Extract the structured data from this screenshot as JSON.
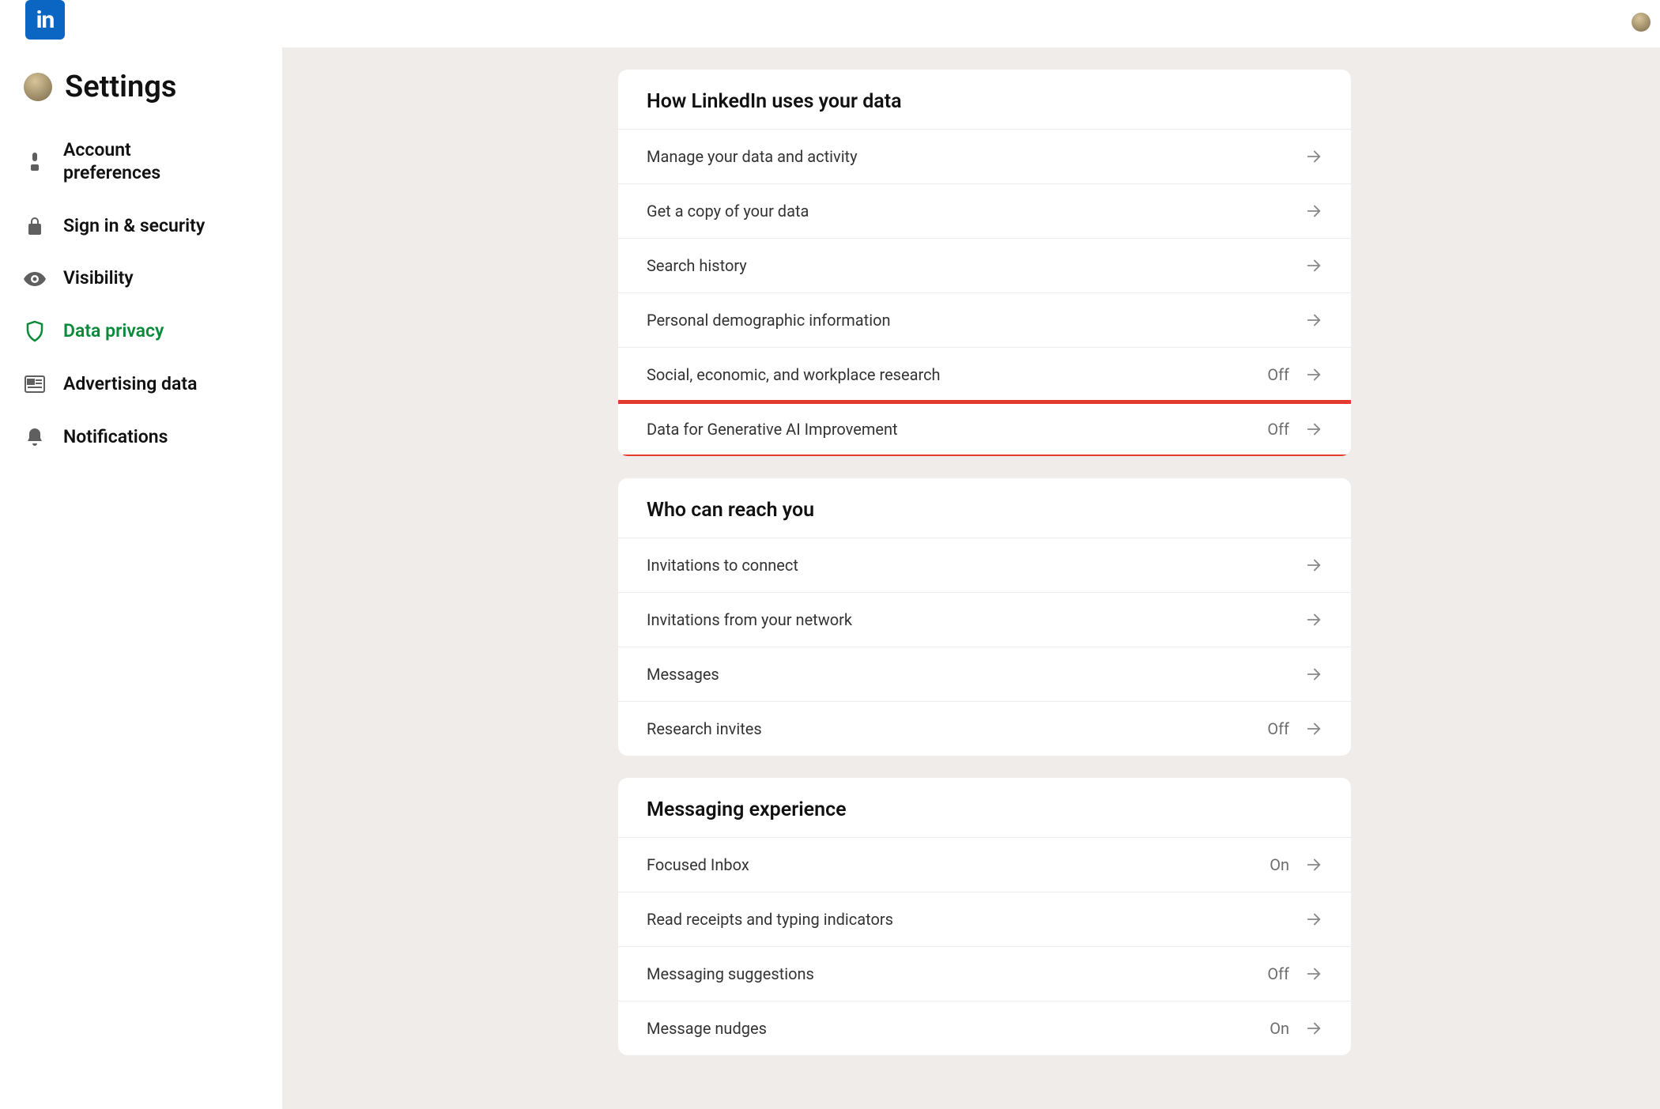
{
  "brand": {
    "logo_text": "in"
  },
  "sidebar": {
    "title": "Settings",
    "items": [
      {
        "label": "Account preferences"
      },
      {
        "label": "Sign in & security"
      },
      {
        "label": "Visibility"
      },
      {
        "label": "Data privacy"
      },
      {
        "label": "Advertising data"
      },
      {
        "label": "Notifications"
      }
    ]
  },
  "main": {
    "sections": [
      {
        "title": "How LinkedIn uses your data",
        "rows": [
          {
            "label": "Manage your data and activity",
            "status": ""
          },
          {
            "label": "Get a copy of your data",
            "status": ""
          },
          {
            "label": "Search history",
            "status": ""
          },
          {
            "label": "Personal demographic information",
            "status": ""
          },
          {
            "label": "Social, economic, and workplace research",
            "status": "Off"
          },
          {
            "label": "Data for Generative AI Improvement",
            "status": "Off",
            "highlight": true
          }
        ]
      },
      {
        "title": "Who can reach you",
        "rows": [
          {
            "label": "Invitations to connect",
            "status": ""
          },
          {
            "label": "Invitations from your network",
            "status": ""
          },
          {
            "label": "Messages",
            "status": ""
          },
          {
            "label": "Research invites",
            "status": "Off"
          }
        ]
      },
      {
        "title": "Messaging experience",
        "rows": [
          {
            "label": "Focused Inbox",
            "status": "On"
          },
          {
            "label": "Read receipts and typing indicators",
            "status": ""
          },
          {
            "label": "Messaging suggestions",
            "status": "Off"
          },
          {
            "label": "Message nudges",
            "status": "On"
          }
        ]
      }
    ]
  }
}
